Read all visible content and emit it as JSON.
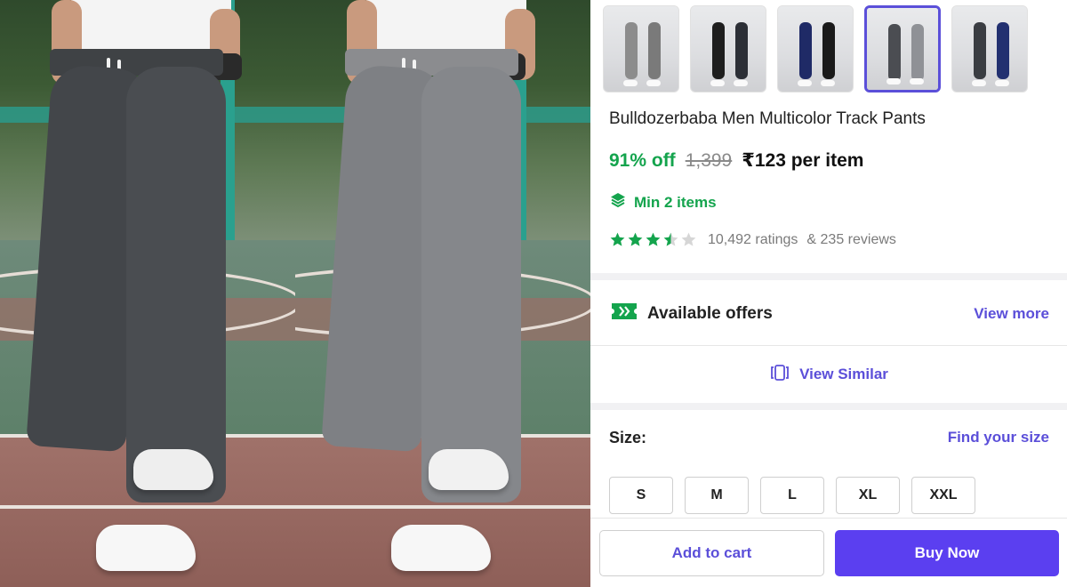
{
  "product": {
    "title": "Bulldozerbaba Men Multicolor Track Pants",
    "discount": "91% off",
    "mrp": "1,399",
    "price": "₹123 per item",
    "min_qty": "Min 2 items",
    "rating_stars": 3.5,
    "ratings_count": "10,492 ratings",
    "reviews_count": "& 235 reviews"
  },
  "gallery": {
    "main_variants": [
      "dark grey",
      "light grey"
    ],
    "thumbnails": [
      {
        "legs": [
          "#8c8c8c",
          "#7a7a7a"
        ],
        "selected": false
      },
      {
        "legs": [
          "#1e1e1e",
          "#2c2f36"
        ],
        "selected": false
      },
      {
        "legs": [
          "#1f2a66",
          "#1a1a1a"
        ],
        "selected": false
      },
      {
        "legs": [
          "#4b4d52",
          "#8f9196"
        ],
        "selected": true
      },
      {
        "legs": [
          "#3a3d42",
          "#223070"
        ],
        "selected": false
      }
    ]
  },
  "offers": {
    "label": "Available offers",
    "view_more": "View more"
  },
  "similar": {
    "label": "View Similar"
  },
  "size": {
    "label": "Size:",
    "find_label": "Find your size",
    "options": [
      "S",
      "M",
      "L",
      "XL",
      "XXL"
    ]
  },
  "actions": {
    "add_to_cart": "Add to cart",
    "buy_now": "Buy Now"
  },
  "colors": {
    "accent": "#5b4fd9",
    "buy_button": "#5b3ff0",
    "discount_green": "#14a44d",
    "star_green": "#14a44d",
    "star_empty": "#d6d6d6"
  }
}
